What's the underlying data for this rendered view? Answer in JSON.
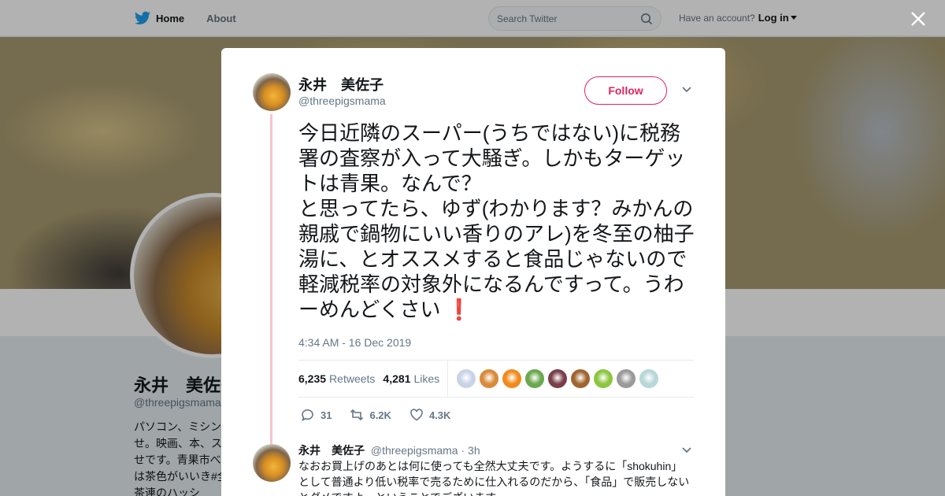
{
  "nav": {
    "home": "Home",
    "about": "About",
    "search_placeholder": "Search Twitter",
    "have_account": "Have an account?",
    "login": "Log in"
  },
  "background_profile": {
    "name": "永井　美佐子",
    "handle": "@threepigsmama",
    "bio": "パソコン、ミシンせ。映画、本、ス幸せです。青果市べ物は茶色がいいき#全茶連のハッシ"
  },
  "tweet": {
    "author_name": "永井　美佐子",
    "author_handle": "@threepigsmama",
    "follow_label": "Follow",
    "text": "今日近隣のスーパー(うちではない)に税務署の査察が入って大騒ぎ。しかもターゲットは青果。なんで？\nと思ってたら、ゆず(わかります？みかんの親戚で鍋物にいい香りのアレ)を冬至の柚子湯に、とオススメすると食品じゃないので軽減税率の対象外になるんですって。うわーめんどくさい",
    "exclamation": "❗",
    "timestamp": "4:34 AM - 16 Dec 2019",
    "retweets_count": "6,235",
    "retweets_label": "Retweets",
    "likes_count": "4,281",
    "likes_label": "Likes",
    "reply_count": "31",
    "retweet_action_count": "6.2K",
    "like_action_count": "4.3K"
  },
  "likers": [
    {
      "color": "#c9d3e6"
    },
    {
      "color": "#d98a3a"
    },
    {
      "color": "#f08a1c"
    },
    {
      "color": "#6aa84f"
    },
    {
      "color": "#7a3f4a"
    },
    {
      "color": "#a0652f"
    },
    {
      "color": "#8cc63f"
    },
    {
      "color": "#9a9a9a"
    },
    {
      "color": "#b8d7d9"
    }
  ],
  "reply": {
    "author_name": "永井　美佐子",
    "author_handle": "@threepigsmama",
    "age": "· 3h",
    "text": "なおお買上げのあとは何に使っても全然大丈夫です。ようするに「shokuhin」として普通より低い税率で売るために仕入れるのだから、「食品」で販売しないとダメですよ、ということでございます。"
  },
  "colors": {
    "twitter_blue": "#1da1f2",
    "follow_red": "#e0245e",
    "thread_line": "#f8c3cf"
  }
}
